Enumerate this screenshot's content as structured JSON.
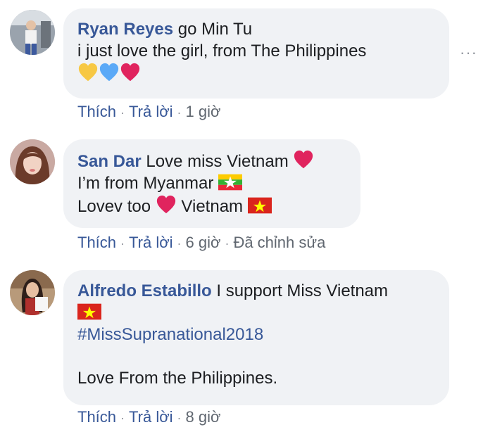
{
  "comments": [
    {
      "author": "Ryan Reyes",
      "lines": [
        "go Min Tu",
        "i just love the girl, from The Philippines"
      ],
      "emojis": [
        "yellow-heart",
        "blue-heart",
        "red-heart"
      ],
      "actions": {
        "like": "Thích",
        "reply": "Trả lời",
        "time": "1 giờ"
      },
      "more": "···"
    },
    {
      "author": "San Dar",
      "lines": [
        "Love miss Vietnam",
        "I’m from Myanmar",
        "Lovev too",
        "Vietnam"
      ],
      "actions": {
        "like": "Thích",
        "reply": "Trả lời",
        "time": "6 giờ",
        "edited": "Đã chỉnh sửa"
      }
    },
    {
      "author": "Alfredo Estabillo",
      "lines": [
        "I support Miss Vietnam",
        "#MissSupranational2018",
        "Love From the Philippines."
      ],
      "actions": {
        "like": "Thích",
        "reply": "Trả lời",
        "time": "8 giờ"
      }
    }
  ],
  "separator": "·",
  "colors": {
    "link": "#385898",
    "bubble": "#f0f2f5",
    "meta": "#606770",
    "heart": "#e0245e",
    "yellow_heart": "#f7c844",
    "blue_heart": "#5aa9f7",
    "vn_red": "#da251d",
    "vn_star": "#ffff00",
    "mm_yellow": "#fecb00",
    "mm_green": "#34b233",
    "mm_red": "#ea2839"
  }
}
